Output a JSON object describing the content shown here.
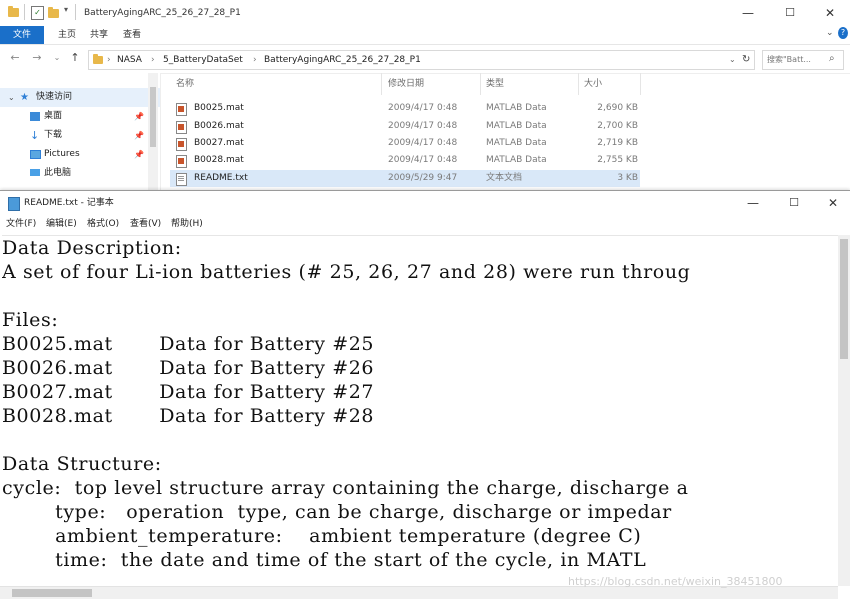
{
  "explorer": {
    "window_title": "BatteryAgingARC_25_26_27_28_P1",
    "ribbon_tabs": [
      "文件",
      "主页",
      "共享",
      "查看"
    ],
    "breadcrumbs": [
      "NASA",
      "5_BatteryDataSet",
      "BatteryAgingARC_25_26_27_28_P1"
    ],
    "search_placeholder": "搜索\"Batt...",
    "nav_items": [
      {
        "label": "快速访问",
        "icon": "star-icon"
      },
      {
        "label": "桌面",
        "icon": "desktop-icon"
      },
      {
        "label": "下载",
        "icon": "download-icon"
      },
      {
        "label": "Pictures",
        "icon": "pictures-icon"
      },
      {
        "label": "此电脑",
        "icon": "computer-icon"
      }
    ],
    "columns": {
      "name": "名称",
      "modified": "修改日期",
      "type": "类型",
      "size": "大小"
    },
    "files": [
      {
        "name": "B0025.mat",
        "modified": "2009/4/17 0:48",
        "type": "MATLAB Data",
        "size": "2,690 KB",
        "icon": "mat-file-icon"
      },
      {
        "name": "B0026.mat",
        "modified": "2009/4/17 0:48",
        "type": "MATLAB Data",
        "size": "2,700 KB",
        "icon": "mat-file-icon"
      },
      {
        "name": "B0027.mat",
        "modified": "2009/4/17 0:48",
        "type": "MATLAB Data",
        "size": "2,719 KB",
        "icon": "mat-file-icon"
      },
      {
        "name": "B0028.mat",
        "modified": "2009/4/17 0:48",
        "type": "MATLAB Data",
        "size": "2,755 KB",
        "icon": "mat-file-icon"
      },
      {
        "name": "README.txt",
        "modified": "2009/5/29 9:47",
        "type": "文本文档",
        "size": "3 KB",
        "icon": "txt-file-icon"
      }
    ],
    "accent_color": "#1a6fc9"
  },
  "notepad": {
    "window_title": "README.txt - 记事本",
    "menu": [
      "文件(F)",
      "编辑(E)",
      "格式(O)",
      "查看(V)",
      "帮助(H)"
    ],
    "lines": [
      "Data Description:",
      "A set of four Li-ion batteries (# 25, 26, 27 and 28) were run throug",
      "",
      "Files:",
      "B0025.mat       Data for Battery #25",
      "B0026.mat       Data for Battery #26",
      "B0027.mat       Data for Battery #27",
      "B0028.mat       Data for Battery #28",
      "",
      "Data Structure:",
      "cycle:  top level structure array containing the charge, discharge a",
      "        type:   operation  type, can be charge, discharge or impedar",
      "        ambient_temperature:    ambient temperature (degree C)",
      "        time:  the date and time of the start of the cycle, in MATL"
    ]
  },
  "watermark": "https://blog.csdn.net/weixin_38451800"
}
